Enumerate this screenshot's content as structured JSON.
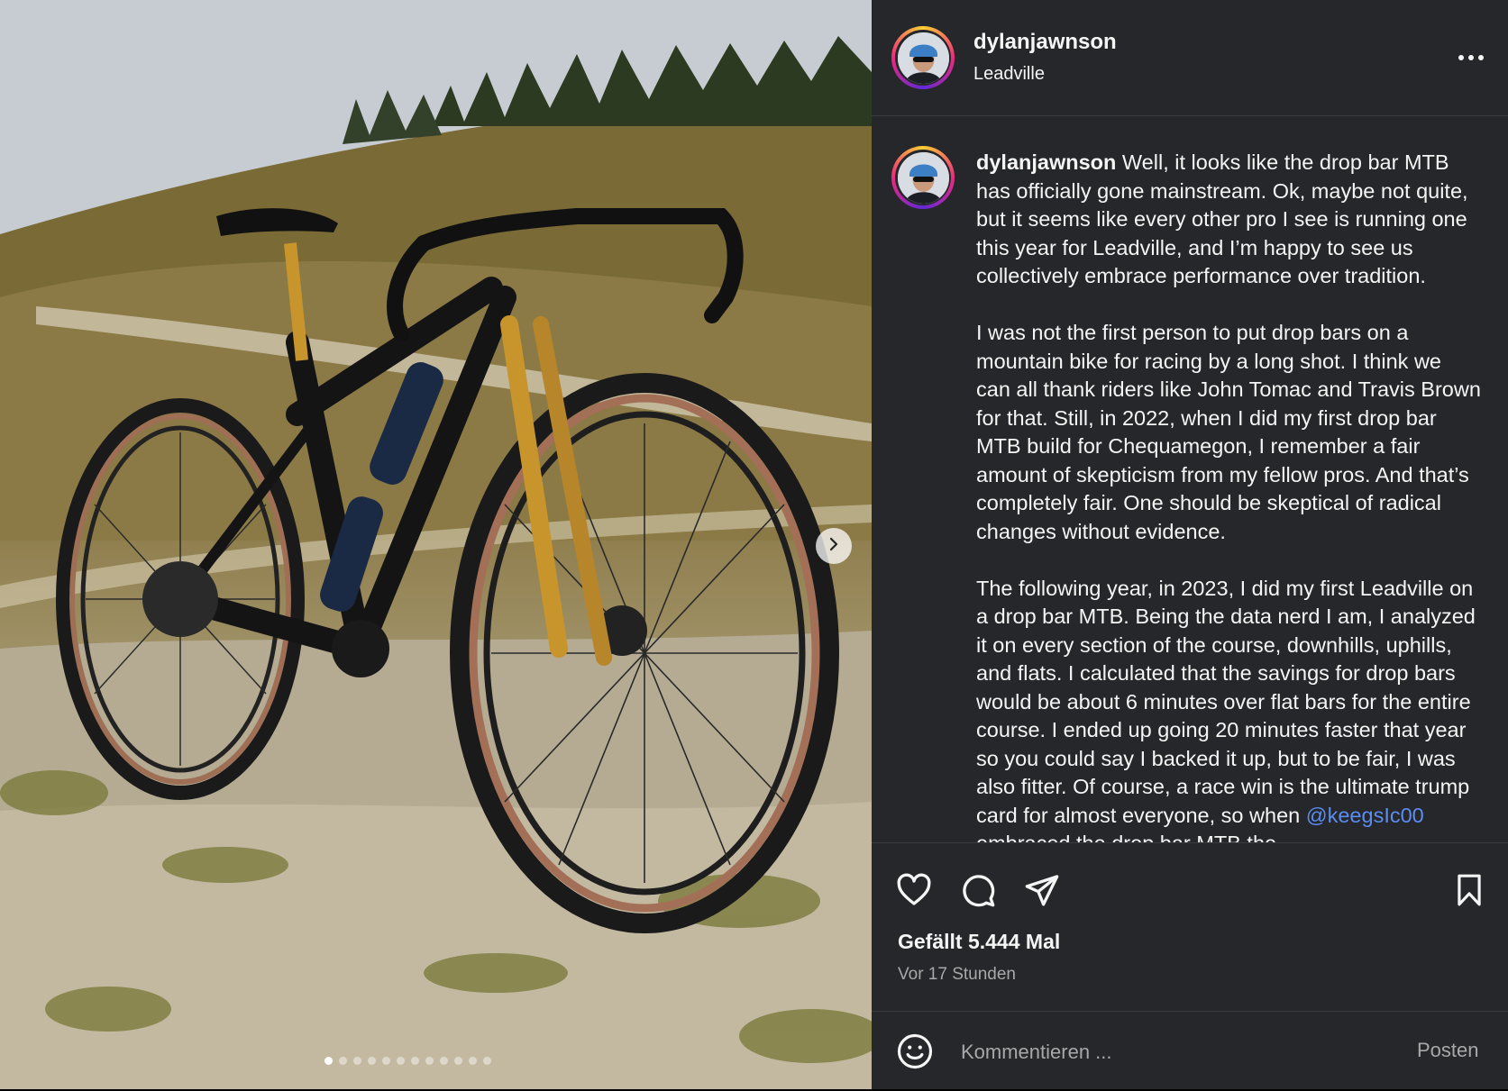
{
  "post": {
    "username": "dylanjawnson",
    "location": "Leadville",
    "more_label": "More options"
  },
  "caption": {
    "username": "dylanjawnson",
    "paragraph1": "Well, it looks like the drop bar MTB has officially gone mainstream. Ok, maybe not quite, but it seems like every other pro I see is running one this year for Leadville, and I’m happy to see us collectively embrace performance over tradition.",
    "paragraph2": "I was not the first person to put drop bars on a mountain bike for racing by a long shot. I think we can all thank riders like John Tomac and Travis Brown for that. Still, in 2022, when I did my first drop bar MTB build for Chequamegon, I remember a fair amount of skepticism from my fellow pros. And that’s completely fair. One should be skeptical of radical changes without evidence.",
    "paragraph3": "The following year, in 2023, I did my first Leadville on a drop bar MTB. Being the data nerd I am, I analyzed it on every section of the course, downhills, uphills, and flats. I calculated that the savings for drop bars would be about 6 minutes over flat bars for the entire course. I ended up going 20 minutes faster that year so you could say I backed it up, but to be fair, I was also fitter. Of course, a race win is the ultimate trump card for almost everyone, so",
    "paragraph3_tail_before": "when ",
    "mention": "@keegsIc00",
    "paragraph3_tail_after": " embraced the drop bar MTB the"
  },
  "actions": {
    "like_icon": "heart-icon",
    "comment_icon": "comment-bubble-icon",
    "share_icon": "paper-plane-icon",
    "save_icon": "bookmark-icon",
    "likes_text": "Gefällt 5.444 Mal",
    "time_text": "Vor 17 Stunden"
  },
  "comment": {
    "emoji_icon": "smiley-icon",
    "placeholder": "Kommentieren ...",
    "post_label": "Posten"
  },
  "carousel": {
    "next_icon": "chevron-right-icon",
    "current_index": 1,
    "total": 12
  },
  "colors": {
    "panel_bg": "#26272b",
    "text": "#f5f5f5",
    "muted": "#a8a8a8",
    "link": "#5b8cf0",
    "fork_gold": "#c8952c"
  }
}
